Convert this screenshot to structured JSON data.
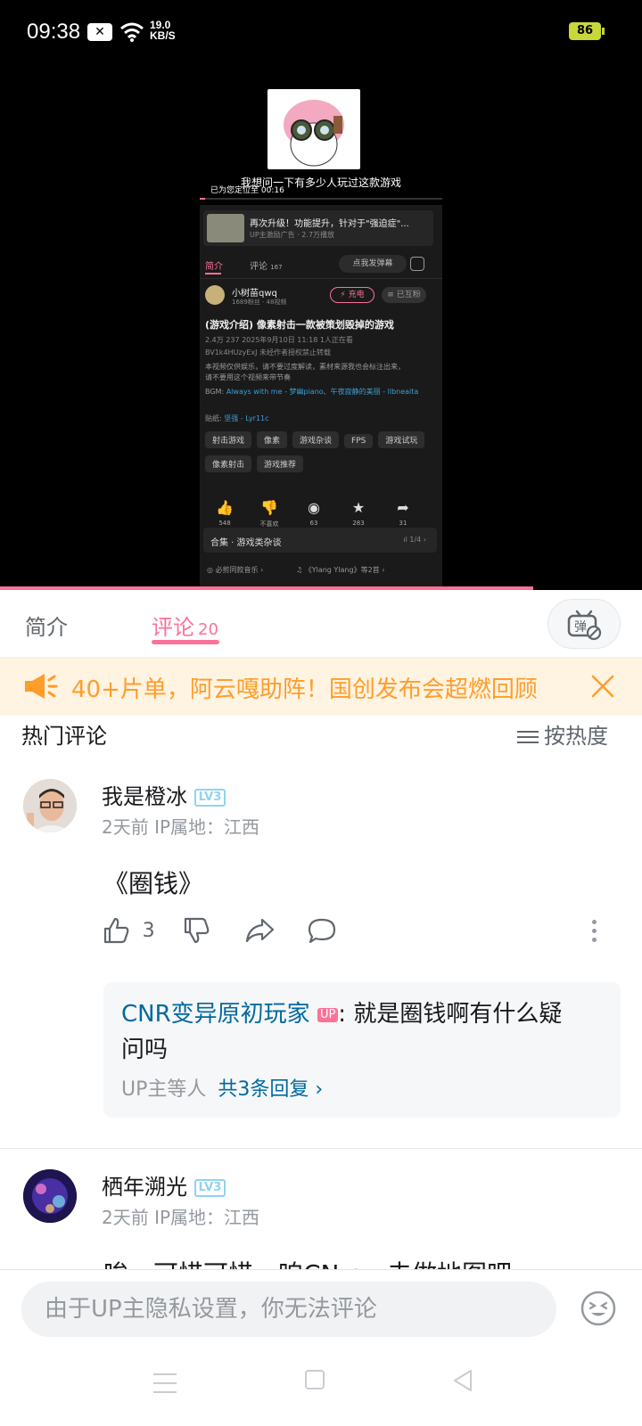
{
  "status_bar": {
    "time": "09:38",
    "speed_value": "19.0",
    "speed_unit": "KB/S",
    "battery": "86"
  },
  "video": {
    "progress_percent": 83,
    "inner": {
      "subtitle": "我想问一下有多少人玩过这款游戏",
      "resume_text": "已为您定位至 00:16",
      "ad_title": "再次升级！功能提升，针对于\"强迫症\"...",
      "ad_meta": "UP主激励广告 · 2.7万播放",
      "tab_intro": "简介",
      "tab_comments": "评论",
      "tab_comments_count": "167",
      "danmaku_placeholder": "点我发弹幕",
      "uploader_name": "小树苗qwq",
      "uploader_meta": "1689粉丝 · 48视频",
      "charge_label": "充电",
      "follow_label": "已互粉",
      "video_title": "(游戏介绍) 像素射击一款被策划毁掉的游戏",
      "stats_line": "2.4万  237  2025年9月10日 11:18  1人正在看",
      "bv_line": "BV1k4HUzyExJ  未经作者授权禁止转载",
      "desc_line1": "本视频仅供娱乐，请不要过度解读，素材来源我也会标注出来，",
      "desc_line2": "请不要用这个视频来带节奏",
      "bgm_label": "BGM:",
      "bgm_value": "Always with me - 梦幽piano、午夜寂静的美丽 - llbneaita",
      "sticker_label": "贴纸:",
      "sticker_value": "坚强 - Lyr11c",
      "tags": [
        "射击游戏",
        "像素",
        "游戏杂谈",
        "FPS",
        "游戏试玩",
        "像素射击",
        "游戏推荐"
      ],
      "actions": [
        {
          "icon": "like",
          "label": "548"
        },
        {
          "icon": "dislike",
          "label": "不喜欢"
        },
        {
          "icon": "coin",
          "label": "63"
        },
        {
          "icon": "favorite",
          "label": "283"
        },
        {
          "icon": "share",
          "label": "31"
        }
      ],
      "collection_label": "合集 · 游戏类杂谈",
      "collection_page": "1/4",
      "bottom_music1": "必剪同款音乐",
      "bottom_music2": "《Ylang Ylang》等2首"
    }
  },
  "tabs": {
    "intro": "简介",
    "comments": "评论",
    "comments_count": "20"
  },
  "banner": {
    "text": "40+片单，阿云嘎助阵！国创发布会超燃回顾"
  },
  "comments_header": {
    "title": "热门评论",
    "sort_label": "按热度"
  },
  "comments": [
    {
      "username": "我是橙冰",
      "level": "LV3",
      "time": "2天前",
      "ip": "IP属地：江西",
      "content": "《圈钱》",
      "like_count": "3",
      "reply": {
        "author": "CNR变异原初玩家",
        "author_badge": "UP",
        "text_line1": ": 就是圈钱啊有什么疑",
        "text_line2": "问吗",
        "footer_prefix": "UP主等人",
        "footer_link": "共3条回复"
      }
    },
    {
      "username": "栖年溯光",
      "level": "LV3",
      "time": "2天前",
      "ip": "IP属地：江西",
      "content": "唉，可惜可惜，咱CN r... 去做地图吧"
    }
  ],
  "bottom_bar": {
    "input_placeholder": "由于UP主隐私设置，你无法评论"
  },
  "colors": {
    "pink": "#fb7299",
    "link_blue": "#00699d",
    "banner_bg": "#fff3e1",
    "banner_text": "#ff9d2a",
    "gray_text": "#9499a0"
  }
}
